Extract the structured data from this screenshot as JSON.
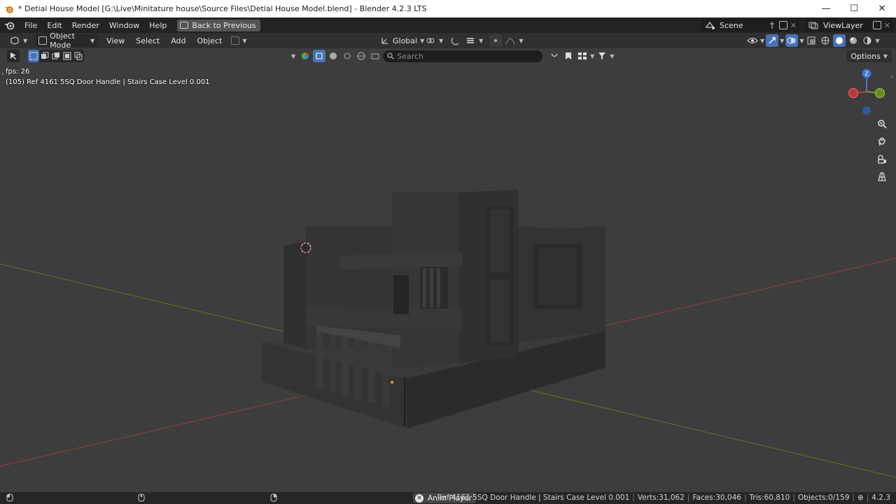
{
  "window": {
    "title": "* Detial House Model [G:\\Live\\Minitature house\\Source Files\\Detial House Model.blend] - Blender 4.2.3 LTS",
    "minimize": "—",
    "maximize": "☐",
    "close": "✕"
  },
  "topbar": {
    "menus": [
      "File",
      "Edit",
      "Render",
      "Window",
      "Help"
    ],
    "back_label": "Back to Previous",
    "scene": "Scene",
    "view_layer": "ViewLayer"
  },
  "header": {
    "mode": "Object Mode",
    "menus": [
      "View",
      "Select",
      "Add",
      "Object"
    ],
    "transform_orientation": "Global",
    "search_placeholder": "Search",
    "options_label": "Options"
  },
  "viewport": {
    "fps": "fps: 26",
    "active_object": "(105) Ref 4161 5SQ Door Handle | Stairs Case Level 0.001",
    "gizmo": {
      "z": "Z"
    },
    "colors": {
      "x_axis": "#b34c4c",
      "y_axis": "#6b8a2f",
      "grid": "#4a4a4a",
      "accent": "#4772b3"
    }
  },
  "statusbar": {
    "anim_player": "Anim Player",
    "object_info": "Ref 4161 5SQ Door Handle | Stairs Case Level 0.001",
    "verts": "Verts:31,062",
    "faces": "Faces:30,046",
    "tris": "Tris:60,810",
    "objects": "Objects:0/159",
    "version": "4.2.3"
  }
}
